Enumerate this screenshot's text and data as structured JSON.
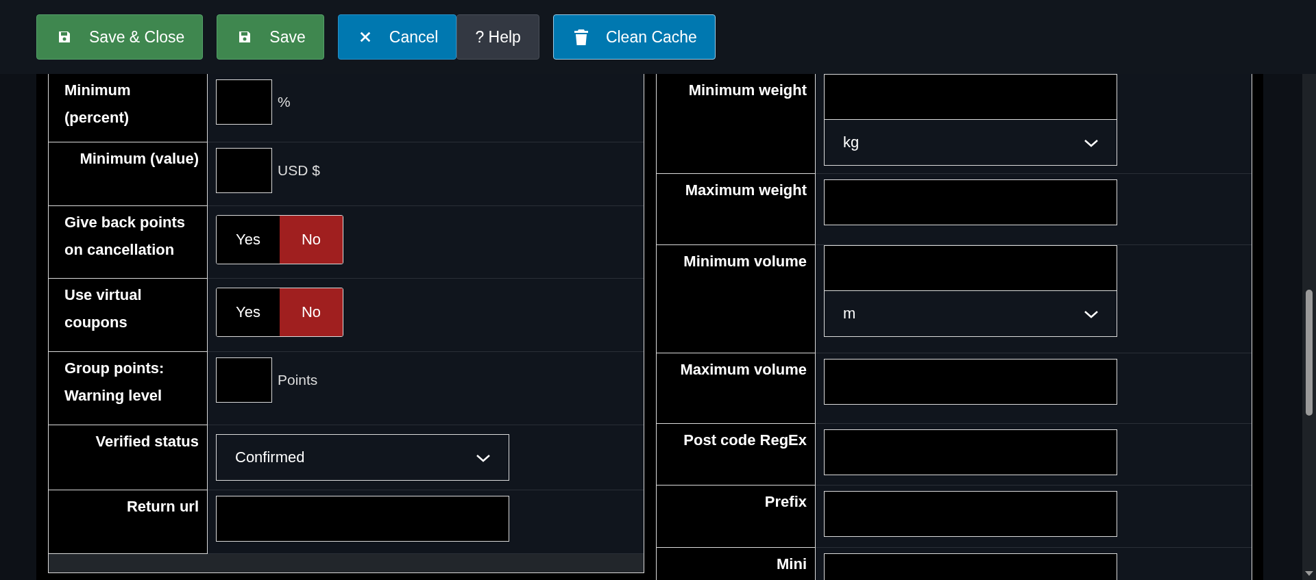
{
  "toolbar": {
    "buttons": [
      {
        "kind": "save",
        "label": "Save & Close"
      },
      {
        "kind": "save",
        "label": "Save"
      },
      {
        "kind": "cancel",
        "label": "Cancel"
      },
      {
        "kind": "help",
        "label": "? Help"
      },
      {
        "kind": "trash",
        "label": "Clean Cache"
      }
    ]
  },
  "left_panel": {
    "rows": [
      {
        "kind": "input_suffix",
        "label": "Minimum (percent)",
        "suffix": "%"
      },
      {
        "kind": "input_suffix",
        "label": "Minimum (value)",
        "suffix": "USD $"
      },
      {
        "kind": "toggle",
        "label": "Give back points on cancellation",
        "options": [
          {
            "label": "Yes",
            "selected": false
          },
          {
            "label": "No",
            "selected": true
          }
        ]
      },
      {
        "kind": "toggle",
        "label": "Use virtual coupons",
        "options": [
          {
            "label": "Yes",
            "selected": false
          },
          {
            "label": "No",
            "selected": true
          }
        ]
      },
      {
        "kind": "input_suffix",
        "label": "Group points: Warning level",
        "suffix": "Points"
      },
      {
        "kind": "select",
        "label": "Verified status",
        "value": "Confirmed"
      },
      {
        "kind": "input",
        "label": "Return url"
      }
    ]
  },
  "right_panel": {
    "rows": [
      {
        "kind": "input_select",
        "label": "Minimum weight",
        "value": "kg"
      },
      {
        "kind": "input",
        "label": "Maximum weight"
      },
      {
        "kind": "input_select",
        "label": "Minimum volume",
        "value": "m"
      },
      {
        "kind": "input",
        "label": "Maximum volume"
      },
      {
        "kind": "input",
        "label": "Post code RegEx"
      },
      {
        "kind": "input",
        "label": "Prefix"
      },
      {
        "kind": "input",
        "label": "Mini"
      }
    ]
  }
}
